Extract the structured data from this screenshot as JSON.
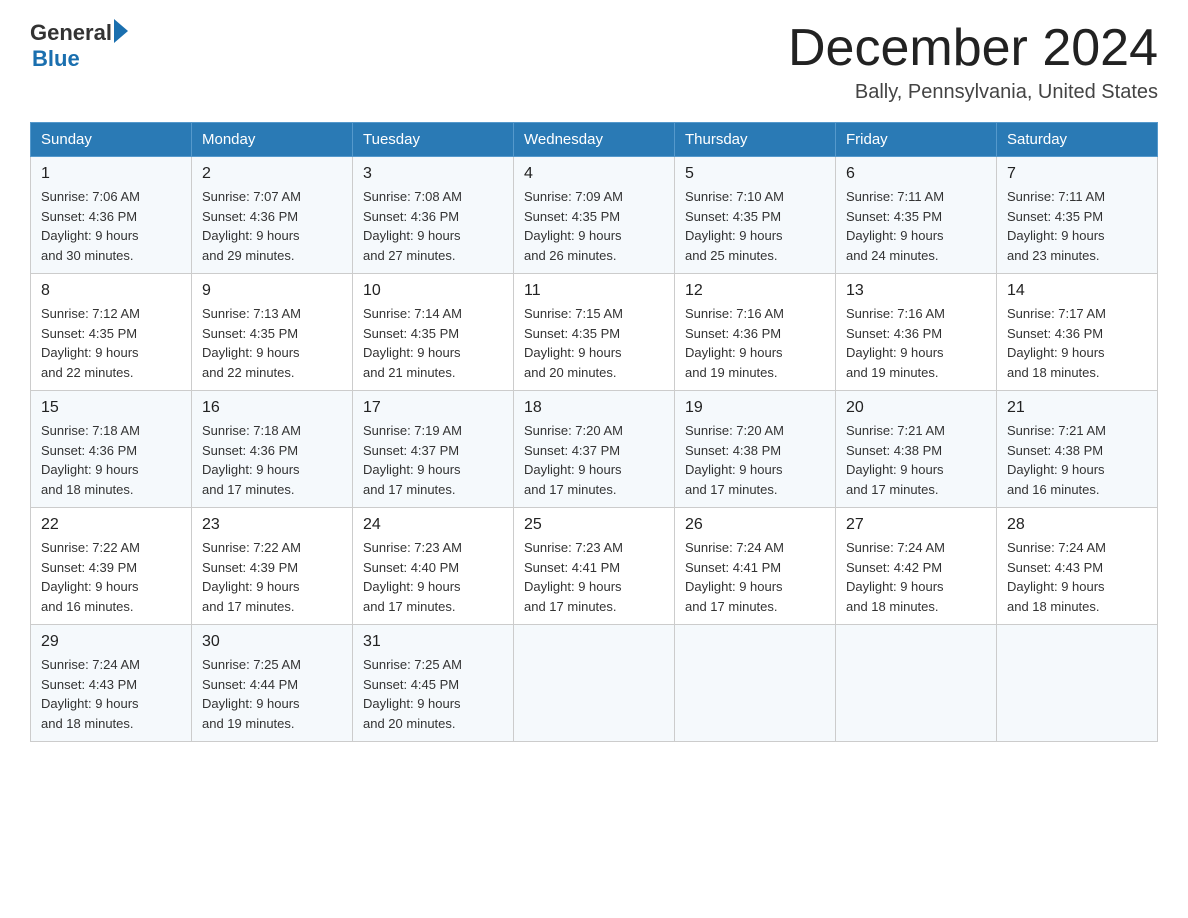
{
  "header": {
    "logo_general": "General",
    "logo_blue": "Blue",
    "month_title": "December 2024",
    "location": "Bally, Pennsylvania, United States"
  },
  "weekdays": [
    "Sunday",
    "Monday",
    "Tuesday",
    "Wednesday",
    "Thursday",
    "Friday",
    "Saturday"
  ],
  "weeks": [
    [
      {
        "day": "1",
        "sunrise": "7:06 AM",
        "sunset": "4:36 PM",
        "daylight": "9 hours and 30 minutes."
      },
      {
        "day": "2",
        "sunrise": "7:07 AM",
        "sunset": "4:36 PM",
        "daylight": "9 hours and 29 minutes."
      },
      {
        "day": "3",
        "sunrise": "7:08 AM",
        "sunset": "4:36 PM",
        "daylight": "9 hours and 27 minutes."
      },
      {
        "day": "4",
        "sunrise": "7:09 AM",
        "sunset": "4:35 PM",
        "daylight": "9 hours and 26 minutes."
      },
      {
        "day": "5",
        "sunrise": "7:10 AM",
        "sunset": "4:35 PM",
        "daylight": "9 hours and 25 minutes."
      },
      {
        "day": "6",
        "sunrise": "7:11 AM",
        "sunset": "4:35 PM",
        "daylight": "9 hours and 24 minutes."
      },
      {
        "day": "7",
        "sunrise": "7:11 AM",
        "sunset": "4:35 PM",
        "daylight": "9 hours and 23 minutes."
      }
    ],
    [
      {
        "day": "8",
        "sunrise": "7:12 AM",
        "sunset": "4:35 PM",
        "daylight": "9 hours and 22 minutes."
      },
      {
        "day": "9",
        "sunrise": "7:13 AM",
        "sunset": "4:35 PM",
        "daylight": "9 hours and 22 minutes."
      },
      {
        "day": "10",
        "sunrise": "7:14 AM",
        "sunset": "4:35 PM",
        "daylight": "9 hours and 21 minutes."
      },
      {
        "day": "11",
        "sunrise": "7:15 AM",
        "sunset": "4:35 PM",
        "daylight": "9 hours and 20 minutes."
      },
      {
        "day": "12",
        "sunrise": "7:16 AM",
        "sunset": "4:36 PM",
        "daylight": "9 hours and 19 minutes."
      },
      {
        "day": "13",
        "sunrise": "7:16 AM",
        "sunset": "4:36 PM",
        "daylight": "9 hours and 19 minutes."
      },
      {
        "day": "14",
        "sunrise": "7:17 AM",
        "sunset": "4:36 PM",
        "daylight": "9 hours and 18 minutes."
      }
    ],
    [
      {
        "day": "15",
        "sunrise": "7:18 AM",
        "sunset": "4:36 PM",
        "daylight": "9 hours and 18 minutes."
      },
      {
        "day": "16",
        "sunrise": "7:18 AM",
        "sunset": "4:36 PM",
        "daylight": "9 hours and 17 minutes."
      },
      {
        "day": "17",
        "sunrise": "7:19 AM",
        "sunset": "4:37 PM",
        "daylight": "9 hours and 17 minutes."
      },
      {
        "day": "18",
        "sunrise": "7:20 AM",
        "sunset": "4:37 PM",
        "daylight": "9 hours and 17 minutes."
      },
      {
        "day": "19",
        "sunrise": "7:20 AM",
        "sunset": "4:38 PM",
        "daylight": "9 hours and 17 minutes."
      },
      {
        "day": "20",
        "sunrise": "7:21 AM",
        "sunset": "4:38 PM",
        "daylight": "9 hours and 17 minutes."
      },
      {
        "day": "21",
        "sunrise": "7:21 AM",
        "sunset": "4:38 PM",
        "daylight": "9 hours and 16 minutes."
      }
    ],
    [
      {
        "day": "22",
        "sunrise": "7:22 AM",
        "sunset": "4:39 PM",
        "daylight": "9 hours and 16 minutes."
      },
      {
        "day": "23",
        "sunrise": "7:22 AM",
        "sunset": "4:39 PM",
        "daylight": "9 hours and 17 minutes."
      },
      {
        "day": "24",
        "sunrise": "7:23 AM",
        "sunset": "4:40 PM",
        "daylight": "9 hours and 17 minutes."
      },
      {
        "day": "25",
        "sunrise": "7:23 AM",
        "sunset": "4:41 PM",
        "daylight": "9 hours and 17 minutes."
      },
      {
        "day": "26",
        "sunrise": "7:24 AM",
        "sunset": "4:41 PM",
        "daylight": "9 hours and 17 minutes."
      },
      {
        "day": "27",
        "sunrise": "7:24 AM",
        "sunset": "4:42 PM",
        "daylight": "9 hours and 18 minutes."
      },
      {
        "day": "28",
        "sunrise": "7:24 AM",
        "sunset": "4:43 PM",
        "daylight": "9 hours and 18 minutes."
      }
    ],
    [
      {
        "day": "29",
        "sunrise": "7:24 AM",
        "sunset": "4:43 PM",
        "daylight": "9 hours and 18 minutes."
      },
      {
        "day": "30",
        "sunrise": "7:25 AM",
        "sunset": "4:44 PM",
        "daylight": "9 hours and 19 minutes."
      },
      {
        "day": "31",
        "sunrise": "7:25 AM",
        "sunset": "4:45 PM",
        "daylight": "9 hours and 20 minutes."
      },
      null,
      null,
      null,
      null
    ]
  ],
  "labels": {
    "sunrise": "Sunrise:",
    "sunset": "Sunset:",
    "daylight": "Daylight:"
  }
}
